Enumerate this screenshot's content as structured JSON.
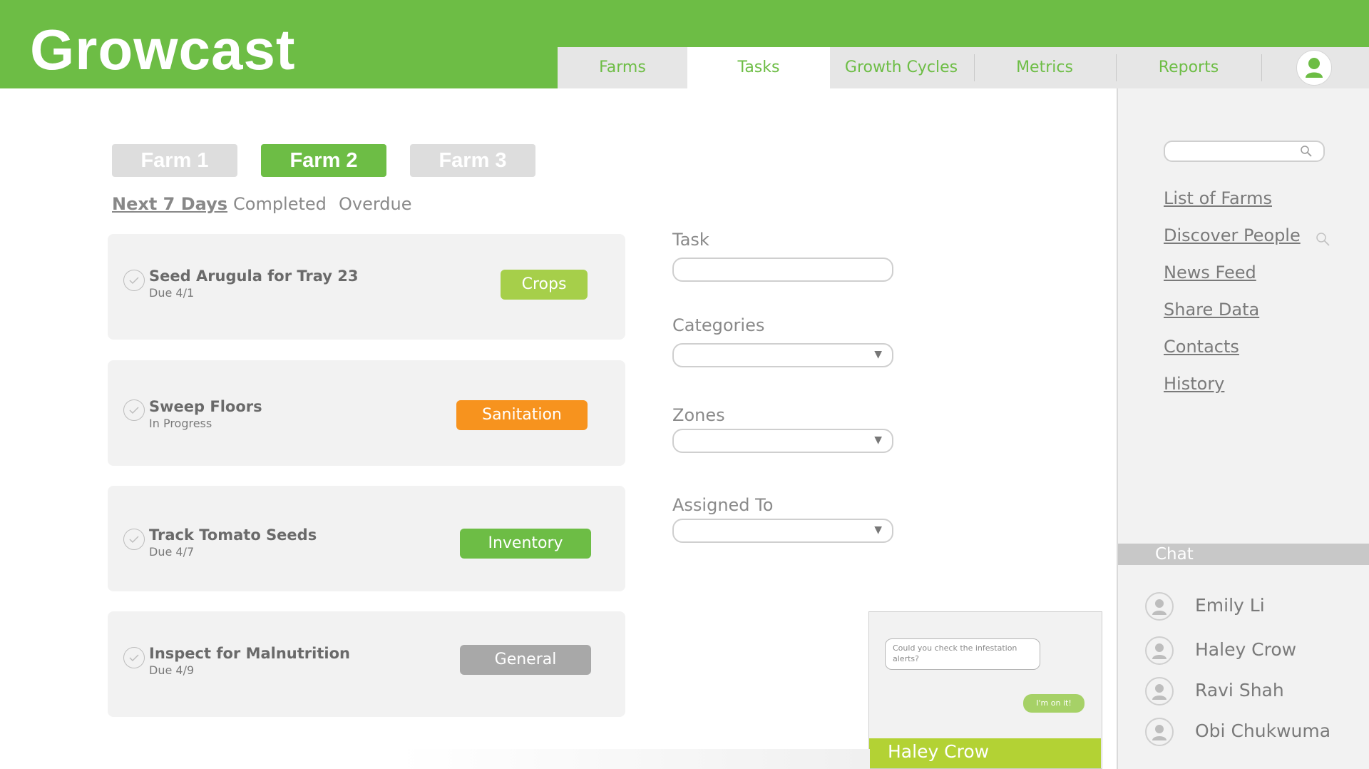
{
  "app": {
    "title": "Growcast"
  },
  "nav": {
    "tabs": [
      {
        "label": "Farms"
      },
      {
        "label": "Tasks"
      },
      {
        "label": "Growth Cycles"
      },
      {
        "label": "Metrics"
      },
      {
        "label": "Reports"
      }
    ],
    "active_tab": "Tasks"
  },
  "farms": {
    "buttons": [
      {
        "label": "Farm 1"
      },
      {
        "label": "Farm 2"
      },
      {
        "label": "Farm 3"
      }
    ],
    "active": "Farm 2"
  },
  "filters": {
    "items": [
      {
        "label": "Next 7 Days"
      },
      {
        "label": "Completed"
      },
      {
        "label": "Overdue"
      }
    ],
    "active": "Next 7 Days"
  },
  "tasks": [
    {
      "title": "Seed Arugula for Tray 23",
      "sub": "Due 4/1",
      "category": "Crops",
      "color": "#a6cf4a"
    },
    {
      "title": "Sweep Floors",
      "sub": "In Progress",
      "category": "Sanitation",
      "color": "#f7931e"
    },
    {
      "title": "Track Tomato Seeds",
      "sub": "Due 4/7",
      "category": "Inventory",
      "color": "#6dbd45"
    },
    {
      "title": "Inspect for Malnutrition",
      "sub": "Due 4/9",
      "category": "General",
      "color": "#a8a8a8"
    }
  ],
  "form": {
    "task_label": "Task",
    "categories_label": "Categories",
    "zones_label": "Zones",
    "assigned_label": "Assigned To"
  },
  "sidebar": {
    "links": [
      {
        "label": "List of Farms"
      },
      {
        "label": "Discover People"
      },
      {
        "label": "News Feed"
      },
      {
        "label": "Share Data"
      },
      {
        "label": "Contacts"
      },
      {
        "label": "History"
      }
    ],
    "chat_title": "Chat",
    "contacts": [
      {
        "name": "Emily Li"
      },
      {
        "name": "Haley Crow"
      },
      {
        "name": "Ravi Shah"
      },
      {
        "name": "Obi Chukwuma"
      }
    ]
  },
  "chat_popup": {
    "contact_name": "Haley Crow",
    "incoming": "Could you check the infestation alerts?",
    "outgoing": "I'm on it!"
  },
  "colors": {
    "brand_green": "#6dbd45",
    "lime": "#b3d234",
    "orange": "#f7931e",
    "gray": "#a8a8a8"
  }
}
